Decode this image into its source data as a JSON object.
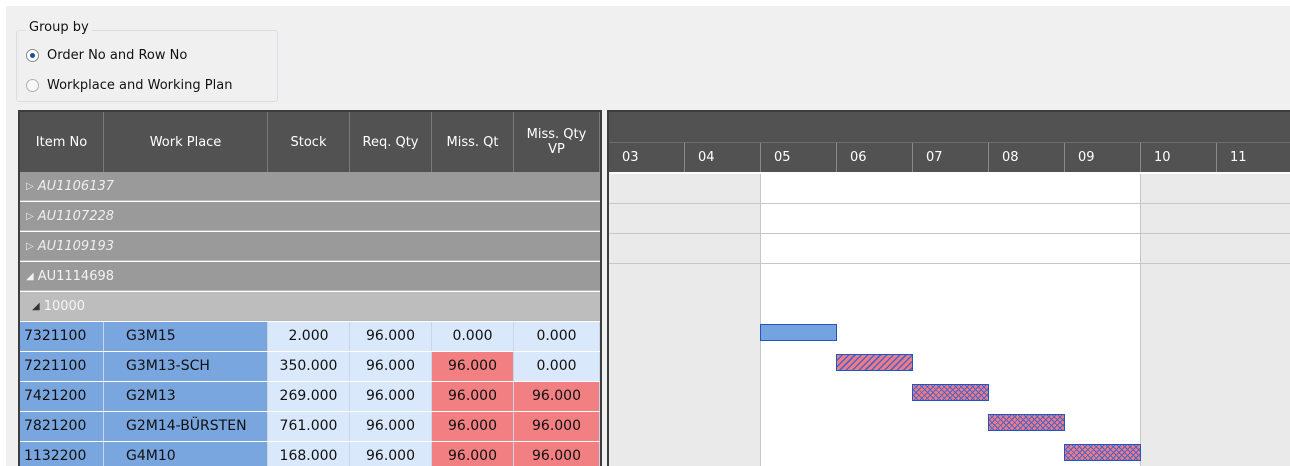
{
  "group_by": {
    "title": "Group by",
    "options": [
      {
        "label": "Order No and Row No",
        "selected": true
      },
      {
        "label": "Workplace and Working Plan",
        "selected": false
      }
    ]
  },
  "grid": {
    "columns": [
      "Item No",
      "Work Place",
      "Stock",
      "Req. Qty",
      "Miss. Qt",
      "Miss. Qty VP"
    ],
    "groups": [
      {
        "label": "AU1106137",
        "expanded": false
      },
      {
        "label": "AU1107228",
        "expanded": false
      },
      {
        "label": "AU1109193",
        "expanded": false
      },
      {
        "label": "AU1114698",
        "expanded": true
      }
    ],
    "subgroup": {
      "label": "10000",
      "expanded": true
    },
    "rows": [
      {
        "item_no": "7321100",
        "work_place": "G3M15",
        "stock": "2.000",
        "req_qty": "96.000",
        "miss_qt": "0.000",
        "miss_qty_vp": "0.000"
      },
      {
        "item_no": "7221100",
        "work_place": "G3M13-SCH",
        "stock": "350.000",
        "req_qty": "96.000",
        "miss_qt": "96.000",
        "miss_qty_vp": "0.000"
      },
      {
        "item_no": "7421200",
        "work_place": "G2M13",
        "stock": "269.000",
        "req_qty": "96.000",
        "miss_qt": "96.000",
        "miss_qty_vp": "96.000"
      },
      {
        "item_no": "7821200",
        "work_place": "G2M14-BÜRSTEN",
        "stock": "761.000",
        "req_qty": "96.000",
        "miss_qt": "96.000",
        "miss_qty_vp": "96.000"
      },
      {
        "item_no": "1132200",
        "work_place": "G4M10",
        "stock": "168.000",
        "req_qty": "96.000",
        "miss_qt": "96.000",
        "miss_qty_vp": "96.000"
      }
    ]
  },
  "gantt": {
    "columns": [
      "03",
      "04",
      "05",
      "06",
      "07",
      "08",
      "09",
      "10",
      "11"
    ],
    "colors": {
      "plain": "#74a3df",
      "missing": "#f07b84",
      "border": "#1f56c4",
      "header": "#525252",
      "missing_cell": "#f28082",
      "item_cell": "#7aa6df",
      "value_cell": "#d9e9fb"
    },
    "bars": [
      {
        "row": "7321100",
        "start": "05",
        "end": "05",
        "pattern": "plain"
      },
      {
        "row": "7221100",
        "start": "06",
        "end": "06",
        "pattern": "diagonal"
      },
      {
        "row": "7421200",
        "start": "07",
        "end": "07",
        "pattern": "crosshatch"
      },
      {
        "row": "7821200",
        "start": "08",
        "end": "08",
        "pattern": "crosshatch"
      },
      {
        "row": "1132200",
        "start": "09",
        "end": "09",
        "pattern": "crosshatch"
      }
    ]
  }
}
